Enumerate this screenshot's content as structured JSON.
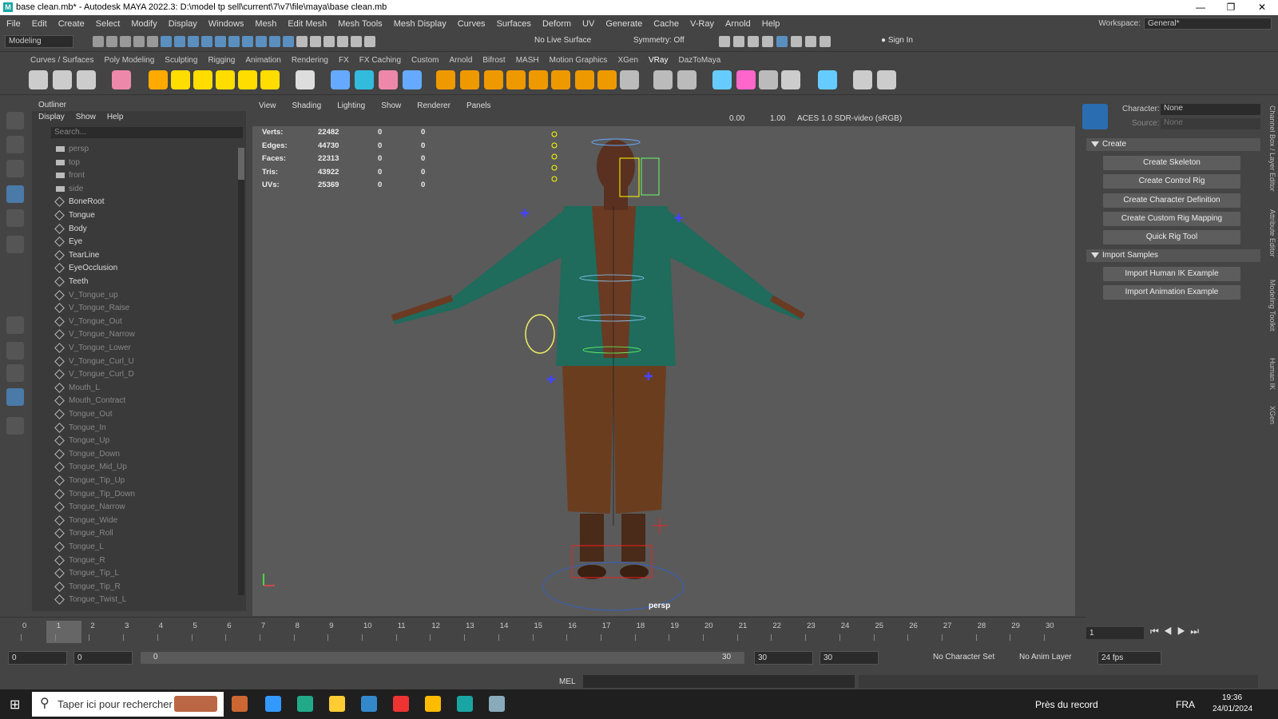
{
  "titlebar": {
    "title": "base clean.mb* - Autodesk MAYA 2022.3: D:\\model tp sell\\current\\7\\v7\\file\\maya\\base clean.mb",
    "logo": "M"
  },
  "menubar": {
    "items": [
      "File",
      "Edit",
      "Create",
      "Select",
      "Modify",
      "Display",
      "Windows",
      "Mesh",
      "Edit Mesh",
      "Mesh Tools",
      "Mesh Display",
      "Curves",
      "Surfaces",
      "Deform",
      "UV",
      "Generate",
      "Cache",
      "V-Ray",
      "Arnold",
      "Help"
    ]
  },
  "workspace": {
    "label": "Workspace:",
    "value": "General*"
  },
  "statusline": {
    "mode": "Modeling",
    "live_surface": "No Live Surface",
    "symmetry": "Symmetry: Off",
    "sign_in": "Sign In"
  },
  "shelf": {
    "tabs": [
      "Curves / Surfaces",
      "Poly Modeling",
      "Sculpting",
      "Rigging",
      "Animation",
      "Rendering",
      "FX",
      "FX Caching",
      "Custom",
      "Arnold",
      "Bifrost",
      "MASH",
      "Motion Graphics",
      "XGen",
      "VRay",
      "DazToMaya"
    ],
    "active_tab": "VRay"
  },
  "outliner": {
    "title": "Outliner",
    "menus": [
      "Display",
      "Show",
      "Help"
    ],
    "search_placeholder": "Search...",
    "items": [
      "persp",
      "top",
      "front",
      "side",
      "BoneRoot",
      "Tongue",
      "Body",
      "Eye",
      "TearLine",
      "EyeOcclusion",
      "Teeth",
      "V_Tongue_up",
      "V_Tongue_Raise",
      "V_Tongue_Out",
      "V_Tongue_Narrow",
      "V_Tongue_Lower",
      "V_Tongue_Curl_U",
      "V_Tongue_Curl_D",
      "Mouth_L",
      "Mouth_Contract",
      "Tongue_Out",
      "Tongue_In",
      "Tongue_Up",
      "Tongue_Down",
      "Tongue_Mid_Up",
      "Tongue_Tip_Up",
      "Tongue_Tip_Down",
      "Tongue_Narrow",
      "Tongue_Wide",
      "Tongue_Roll",
      "Tongue_L",
      "Tongue_R",
      "Tongue_Tip_L",
      "Tongue_Tip_R",
      "Tongue_Twist_L"
    ]
  },
  "viewport": {
    "menus": [
      "View",
      "Shading",
      "Lighting",
      "Show",
      "Renderer",
      "Panels"
    ],
    "exposure": "0.00",
    "gamma": "1.00",
    "color_space": "ACES 1.0 SDR-video (sRGB)",
    "camera": "persp",
    "stats": [
      {
        "label": "Verts:",
        "v1": "22482",
        "v2": "0",
        "v3": "0"
      },
      {
        "label": "Edges:",
        "v1": "44730",
        "v2": "0",
        "v3": "0"
      },
      {
        "label": "Faces:",
        "v1": "22313",
        "v2": "0",
        "v3": "0"
      },
      {
        "label": "Tris:",
        "v1": "43922",
        "v2": "0",
        "v3": "0"
      },
      {
        "label": "UVs:",
        "v1": "25369",
        "v2": "0",
        "v3": "0"
      }
    ]
  },
  "humanik": {
    "character_label": "Character:",
    "character_value": "None",
    "source_label": "Source:",
    "source_value": "None",
    "create_section": "Create",
    "create_buttons": [
      "Create Skeleton",
      "Create Control Rig",
      "Create Character Definition",
      "Create Custom Rig Mapping",
      "Quick Rig Tool"
    ],
    "import_section": "Import Samples",
    "import_buttons": [
      "Import Human IK Example",
      "Import Animation Example"
    ],
    "side_tabs": [
      "Channel Box / Layer Editor",
      "Attribute Editor",
      "Modeling Toolkit",
      "Human IK",
      "XGen"
    ]
  },
  "timeline": {
    "ticks": [
      "0",
      "1",
      "2",
      "3",
      "4",
      "5",
      "6",
      "7",
      "8",
      "9",
      "10",
      "11",
      "12",
      "13",
      "14",
      "15",
      "16",
      "17",
      "18",
      "19",
      "20",
      "21",
      "22",
      "23",
      "24",
      "25",
      "26",
      "27",
      "28",
      "29",
      "30"
    ],
    "current_frame": "1"
  },
  "range": {
    "start": "0",
    "anim_start": "0",
    "slider_start": "0",
    "slider_end": "30",
    "end": "30",
    "anim_end": "30",
    "character_set": "No Character Set",
    "anim_layer": "No Anim Layer",
    "fps": "24 fps"
  },
  "cmdline": {
    "lang": "MEL"
  },
  "taskbar": {
    "search": "Taper ici pour rechercher",
    "record": "Près du record",
    "lang": "FRA",
    "time": "19:36",
    "date": "24/01/2024"
  },
  "colors": {
    "maya_teal": "#1aa5a5",
    "accent_blue": "#4a7aa8",
    "viewport_bg": "#5a5a5a"
  }
}
